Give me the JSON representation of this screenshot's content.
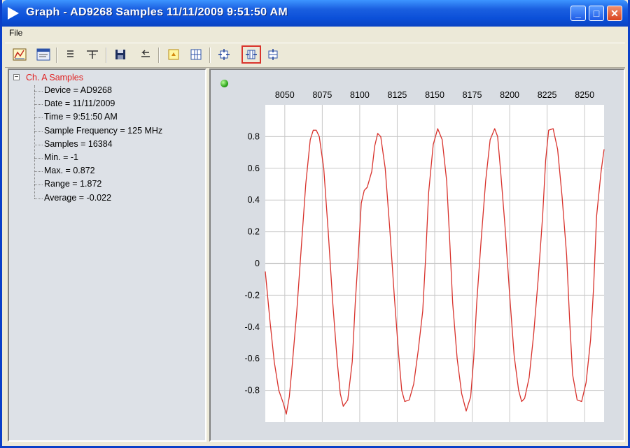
{
  "window": {
    "title": "Graph - AD9268 Samples 11/11/2009 9:51:50 AM",
    "buttons": {
      "minimize": "_",
      "maximize": "□",
      "close": "✕"
    }
  },
  "menu": {
    "file": "File"
  },
  "toolbar": {
    "icons": [
      "chart-icon",
      "window-icon",
      "list-icon",
      "filter-icon",
      "save-icon",
      "undo-icon",
      "marker-icon",
      "grid-icon",
      "zoom-fit-icon",
      "zoom-x-icon",
      "zoom-y-icon"
    ],
    "selected": "zoom-x-icon"
  },
  "tree": {
    "root": "Ch. A Samples",
    "items": [
      "Device = AD9268",
      "Date = 11/11/2009",
      "Time = 9:51:50 AM",
      "Sample Frequency = 125 MHz",
      "Samples = 16384",
      "Min. = -1",
      "Max. = 0.872",
      "Range = 1.872",
      "Average = -0.022"
    ]
  },
  "colors": {
    "trace": "#d8322c",
    "titlebar": "#0b4fd8",
    "tree_root": "#e02020"
  },
  "chart_data": {
    "type": "line",
    "title": "",
    "xlabel": "",
    "ylabel": "",
    "xlim": [
      8037,
      8263
    ],
    "ylim": [
      -1.0,
      1.0
    ],
    "x_ticks": [
      8050,
      8075,
      8100,
      8125,
      8150,
      8175,
      8200,
      8225,
      8250
    ],
    "y_ticks": [
      0.8,
      0.6,
      0.4,
      0.2,
      0,
      -0.2,
      -0.4,
      -0.6,
      -0.8
    ],
    "x_tick_labels": [
      "8050",
      "8075",
      "8100",
      "8125",
      "8150",
      "8175",
      "8200",
      "8225",
      "8250"
    ],
    "y_tick_labels": [
      "0.8",
      "0.6",
      "0.4",
      "0.2",
      "0",
      "-0.2",
      "-0.4",
      "-0.6",
      "-0.8"
    ],
    "grid": true,
    "x_axis_position": "top",
    "series": [
      {
        "x": [
          8037,
          8040,
          8043,
          8046,
          8049,
          8051,
          8053,
          8055,
          8058,
          8061,
          8064,
          8067,
          8069,
          8071,
          8073,
          8076,
          8079,
          8082,
          8085,
          8087,
          8089,
          8092,
          8095,
          8097,
          8099,
          8101,
          8103,
          8105,
          8108,
          8110,
          8112,
          8114,
          8117,
          8120,
          8123,
          8126,
          8128,
          8130,
          8133,
          8136,
          8139,
          8142,
          8144,
          8146,
          8149,
          8152,
          8155,
          8158,
          8160,
          8162,
          8165,
          8168,
          8171,
          8174,
          8176,
          8178,
          8181,
          8184,
          8187,
          8190,
          8192,
          8194,
          8197,
          8200,
          8203,
          8206,
          8208,
          8210,
          8213,
          8216,
          8219,
          8222,
          8224,
          8226,
          8229,
          8232,
          8235,
          8238,
          8240,
          8242,
          8245,
          8248,
          8251,
          8254,
          8256,
          8258,
          8261,
          8263
        ],
        "y": [
          -0.05,
          -0.35,
          -0.62,
          -0.8,
          -0.88,
          -0.95,
          -0.84,
          -0.64,
          -0.3,
          0.1,
          0.5,
          0.78,
          0.84,
          0.84,
          0.8,
          0.6,
          0.2,
          -0.25,
          -0.62,
          -0.82,
          -0.9,
          -0.86,
          -0.62,
          -0.25,
          0.05,
          0.38,
          0.46,
          0.48,
          0.58,
          0.74,
          0.82,
          0.8,
          0.6,
          0.22,
          -0.2,
          -0.58,
          -0.8,
          -0.87,
          -0.86,
          -0.76,
          -0.55,
          -0.3,
          0.05,
          0.45,
          0.75,
          0.85,
          0.78,
          0.52,
          0.15,
          -0.25,
          -0.6,
          -0.82,
          -0.93,
          -0.84,
          -0.6,
          -0.25,
          0.15,
          0.52,
          0.78,
          0.85,
          0.8,
          0.58,
          0.22,
          -0.2,
          -0.58,
          -0.8,
          -0.87,
          -0.85,
          -0.72,
          -0.45,
          -0.1,
          0.3,
          0.65,
          0.84,
          0.85,
          0.72,
          0.42,
          0.05,
          -0.35,
          -0.7,
          -0.86,
          -0.87,
          -0.75,
          -0.48,
          -0.15,
          0.3,
          0.58,
          0.72
        ]
      }
    ]
  }
}
